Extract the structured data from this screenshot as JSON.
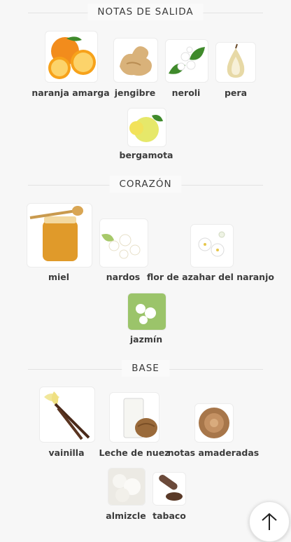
{
  "sections": {
    "top": {
      "title": "NOTAS DE SALIDA",
      "notes": [
        "naranja amarga",
        "jengibre",
        "neroli",
        "pera",
        "bergamota"
      ]
    },
    "heart": {
      "title": "CORAZÓN",
      "notes": [
        "miel",
        "nardos",
        "flor de azahar del naranjo",
        "jazmín"
      ]
    },
    "base": {
      "title": "BASE",
      "notes": [
        "vainilla",
        "Leche de nuez",
        "notas amaderadas",
        "almizcle",
        "tabaco"
      ]
    }
  },
  "icons": {
    "scroll_top": "arrow-up-icon"
  }
}
